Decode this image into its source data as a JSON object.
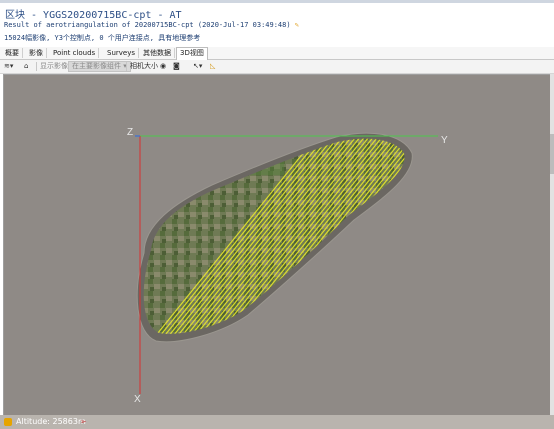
{
  "window": {
    "title": "区块 - YGGS20200715BC-cpt - AT",
    "subtitle": "Result of aerotriangulation of 20200715BC-cpt (2020-Jul-17 03:49:48)",
    "info": "15024幅影像, Y3个控制点, 0 个用户连接点, 具有地理参考"
  },
  "tabs": [
    {
      "label": "概要"
    },
    {
      "label": "影像"
    },
    {
      "label": "Point clouds"
    },
    {
      "label": "Surveys"
    },
    {
      "label": "其他数据"
    },
    {
      "label": "3D视图",
      "active": true
    }
  ],
  "toolbar": {
    "display_images_label": "显示影像",
    "image_group_select": "在主要影像组件",
    "camera_size_label": "相机大小"
  },
  "viewport": {
    "axis_z": "Z",
    "axis_y": "Y",
    "axis_x": "X",
    "colors": {
      "background": "#8f8a86",
      "tracks": "#e8e82a",
      "axis_x": "#d93030",
      "axis_y": "#4cc84c"
    }
  },
  "status": {
    "altitude": "Altitude: 25863m"
  },
  "icons": [
    "layers-icon",
    "home-icon",
    "eye-icon",
    "camera-icon",
    "pointer-icon",
    "ruler-icon",
    "edit-icon",
    "cursor-icon"
  ]
}
